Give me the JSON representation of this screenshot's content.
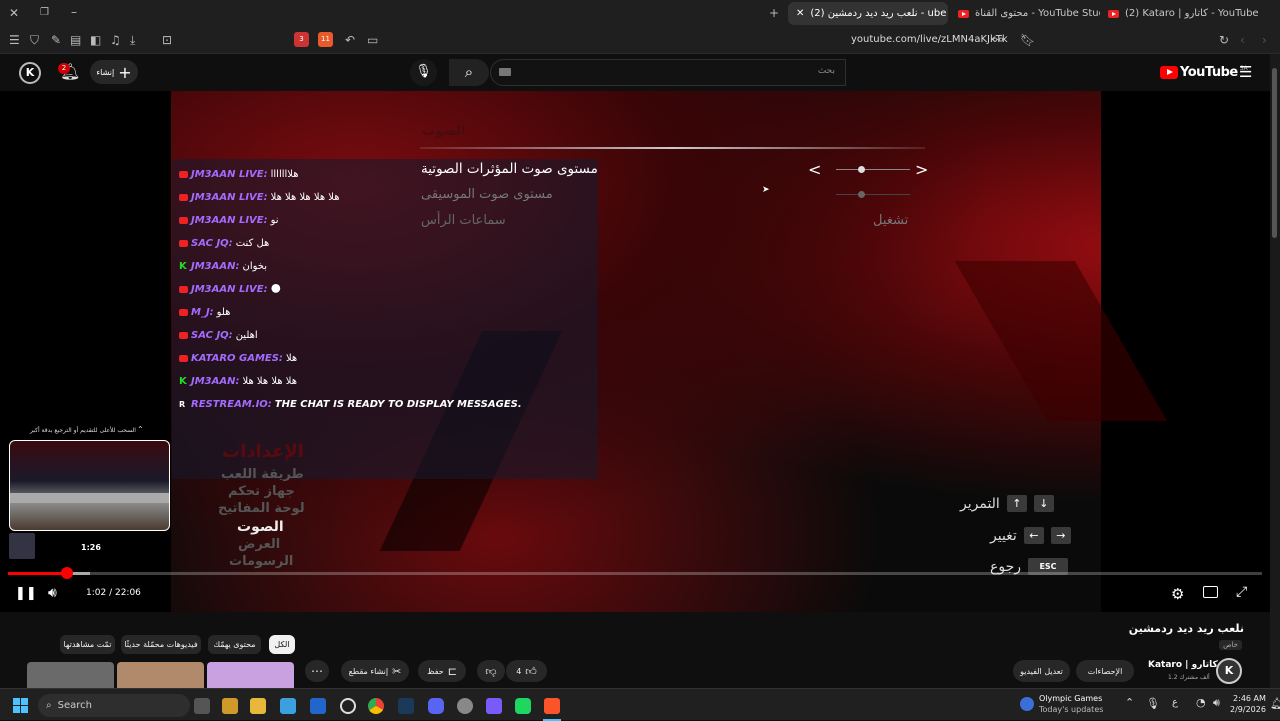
{
  "browser": {
    "tabs": [
      {
        "title": "(2) Kataro | كاتارو - YouTube"
      },
      {
        "title": "محتوى القناة - YouTube Studio"
      },
      {
        "title": "(2) نلعب ريد ديد ردمشين - ube"
      }
    ],
    "url": "youtube.com/live/zLMN4aKJkTk",
    "notif_badge_a": "3",
    "notif_badge_b": "11"
  },
  "yt": {
    "logo_text": "YouTube",
    "country": "SA",
    "search_placeholder": "بحث",
    "create_label": "إنشاء",
    "notif_count": "2"
  },
  "game": {
    "sound_header": "الصوت",
    "options": [
      "مستوى صوت المؤثرات الصوتية",
      "مستوى صوت الموسيقى",
      "سماعات الرأس"
    ],
    "headphones_value": "تشغيل",
    "settings_title": "الإعدادات",
    "settings_menu": [
      "طريقة اللعب",
      "جهاز تحكم",
      "لوحة المفاتيح",
      "الصوت",
      "العرض",
      "الرسومات"
    ],
    "hints": [
      {
        "label": "التمرير",
        "keys": [
          "↑",
          "↓"
        ]
      },
      {
        "label": "تغيير",
        "keys": [
          "←",
          "→"
        ]
      },
      {
        "label": "رجوع",
        "keys": [
          "ESC"
        ]
      }
    ]
  },
  "chat": [
    {
      "src": "yt",
      "name": "JM3AAN LIVE:",
      "text": "هلااااااا",
      "color": "#a46bff"
    },
    {
      "src": "yt",
      "name": "JM3AAN LIVE:",
      "text": "هلا هلا هلا هلا هلا",
      "color": "#a46bff"
    },
    {
      "src": "yt",
      "name": "JM3AAN LIVE:",
      "text": "نو",
      "color": "#a46bff"
    },
    {
      "src": "yt",
      "name": "SAC JQ:",
      "text": "هل كنت",
      "color": "#a46bff"
    },
    {
      "src": "k",
      "name": "JM3AAN:",
      "text": "بخوان",
      "color": "#a46bff"
    },
    {
      "src": "yt",
      "name": "JM3AAN LIVE:",
      "text": "🌑",
      "color": "#a46bff"
    },
    {
      "src": "yt",
      "name": "M_J:",
      "text": "هلو",
      "color": "#a46bff"
    },
    {
      "src": "yt",
      "name": "SAC JQ:",
      "text": "اهلين",
      "color": "#a46bff"
    },
    {
      "src": "yt",
      "name": "KATARO GAMES:",
      "text": "هلا",
      "color": "#a46bff"
    },
    {
      "src": "k",
      "name": "JM3AAN:",
      "text": "هلا هلا هلا هلا",
      "color": "#a46bff"
    },
    {
      "src": "r",
      "name": "RESTREAM.IO:",
      "text": "THE CHAT IS READY TO DISPLAY MESSAGES.",
      "color": "#a46bff"
    }
  ],
  "player": {
    "seek_hint": "السحب للأعلى للتقديم أو الترجيع بدقة أكبر",
    "preview_time": "1:26",
    "time": "1:02 / 22:06",
    "progress_played": 0.047,
    "progress_buffered": 0.065
  },
  "video": {
    "title": "نلعب ريد ديد ردمشين",
    "visibility": "خاص",
    "channel_name": "Kataro | كاتارو",
    "subscribers": "1.2 ألف مشترك",
    "analytics_label": "الإحصاءات",
    "edit_label": "تعديل الفيديو",
    "like_count": "4",
    "save_label": "حفظ",
    "clip_label": "إنشاء مقطع"
  },
  "chips": [
    "الكل",
    "محتوى يهمّك",
    "فيديوهات محمّلة حديثًا",
    "تمّت مشاهدتها"
  ],
  "taskbar": {
    "search_label": "Search",
    "news_title": "Olympic Games",
    "news_sub": "Today's updates",
    "lang": "ع",
    "time": "2:46 AM",
    "date": "2/9/2026"
  },
  "colors": {
    "accent": "#ff0000",
    "chat_name": "#a46bff",
    "kick": "#22dd22"
  }
}
